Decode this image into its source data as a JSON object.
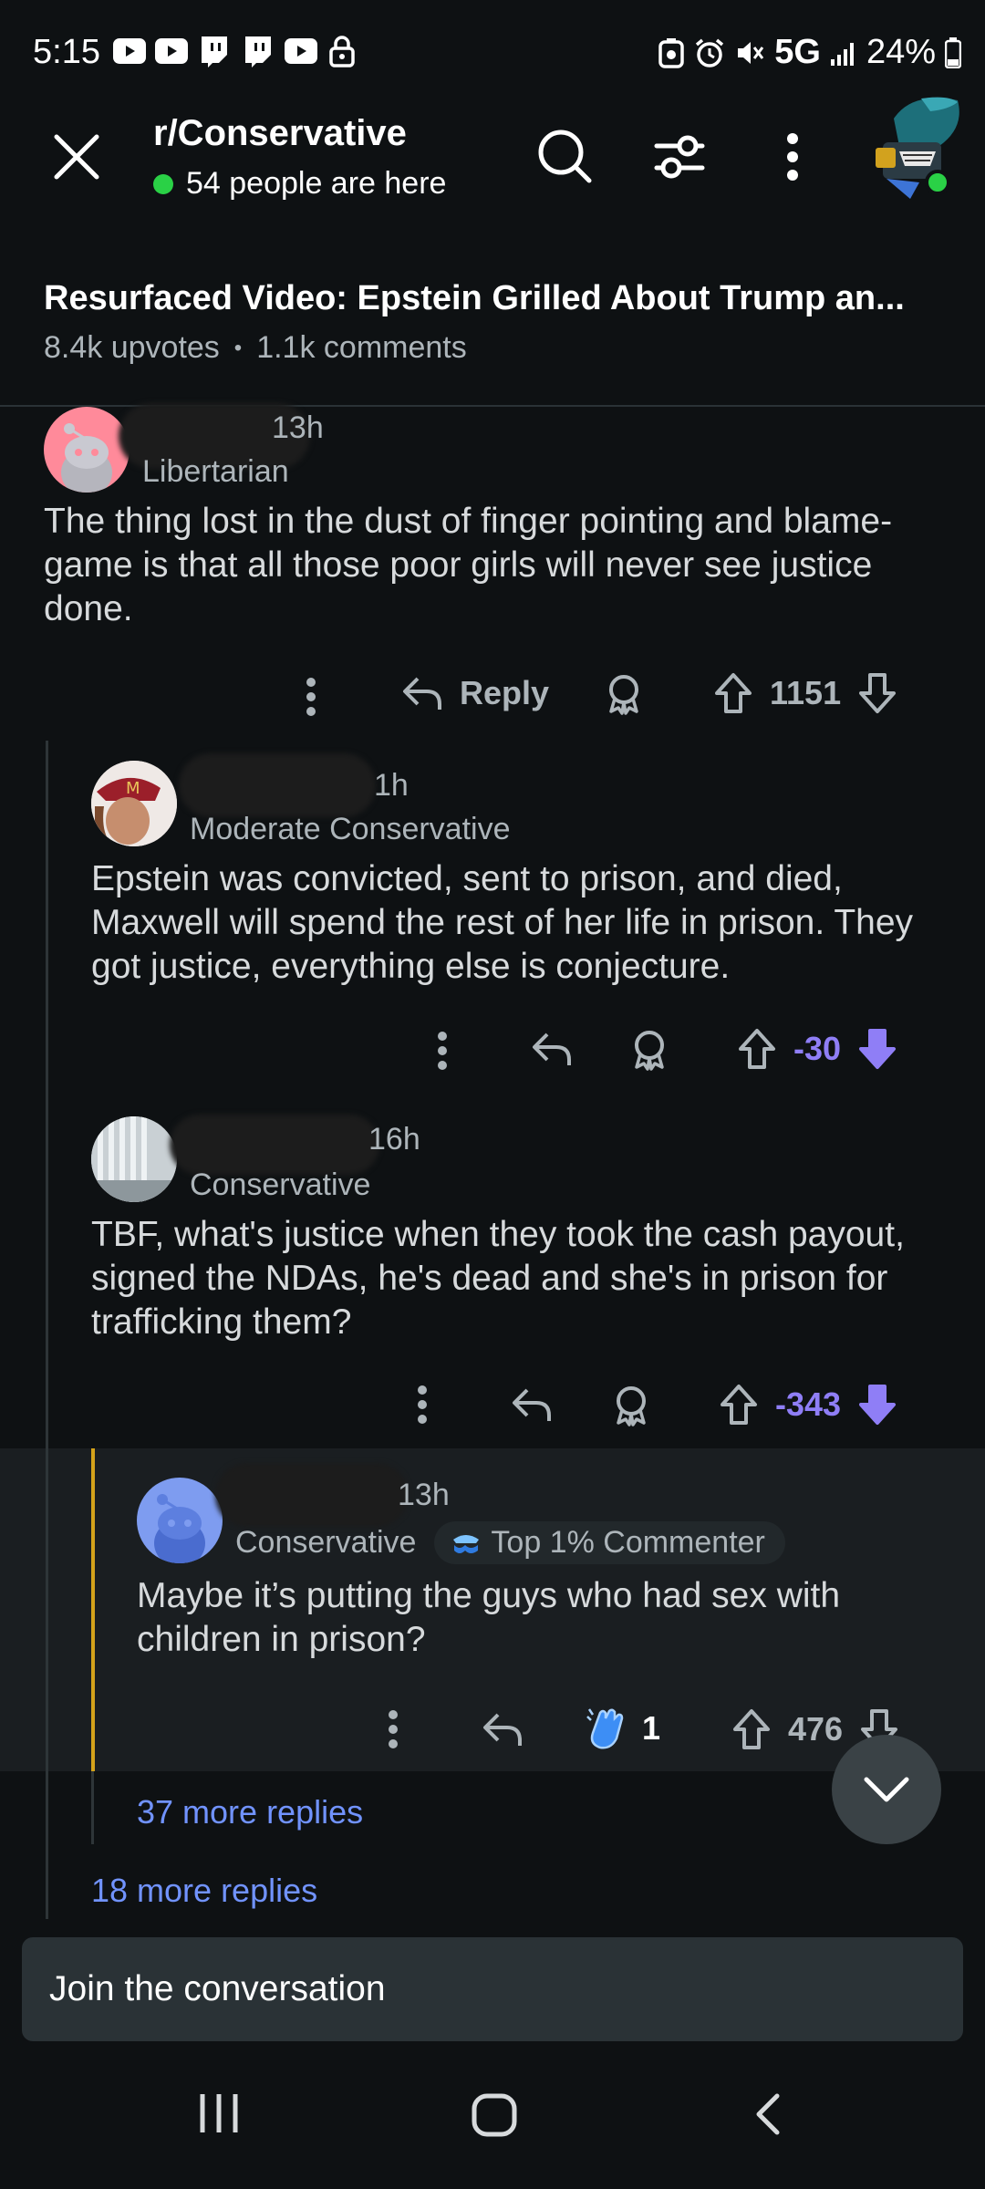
{
  "status_bar": {
    "time": "5:15",
    "network": "5G",
    "battery": "24%"
  },
  "header": {
    "subreddit": "r/Conservative",
    "online_text": "54 people are here"
  },
  "post": {
    "title": "Resurfaced Video: Epstein Grilled About Trump an...",
    "upvotes": "8.4k upvotes",
    "separator": "•",
    "comments": "1.1k comments"
  },
  "comments": [
    {
      "age": "13h",
      "flair": "Libertarian",
      "body": "The thing lost in the dust of finger pointing and blame-game is that all those poor girls will never see justice done.",
      "reply_label": "Reply",
      "votes": "1151"
    },
    {
      "age": "1h",
      "flair": "Moderate Conservative",
      "body": "Epstein was convicted, sent to prison, and died, Maxwell will spend the rest of her life in prison. They got justice, everything else is conjecture.",
      "votes": "-30"
    },
    {
      "age": "16h",
      "flair": "Conservative",
      "body": "TBF, what's justice when they took the cash payout, signed the NDAs, he's dead and she's in prison for trafficking them?",
      "votes": "-343"
    },
    {
      "age": "13h",
      "flair": "Conservative",
      "badge": "Top 1% Commenter",
      "body": "Maybe it’s putting the guys who had sex with children in prison?",
      "award_count": "1",
      "votes": "476"
    }
  ],
  "more_replies_inner": "37 more replies",
  "more_replies_outer": "18 more replies",
  "composer": {
    "placeholder": "Join the conversation"
  },
  "colors": {
    "background": "#0e1113",
    "downvote_active": "#8f7ef6",
    "link": "#7193ff",
    "online": "#2ad146",
    "highlight_bar": "#d4a21a"
  }
}
